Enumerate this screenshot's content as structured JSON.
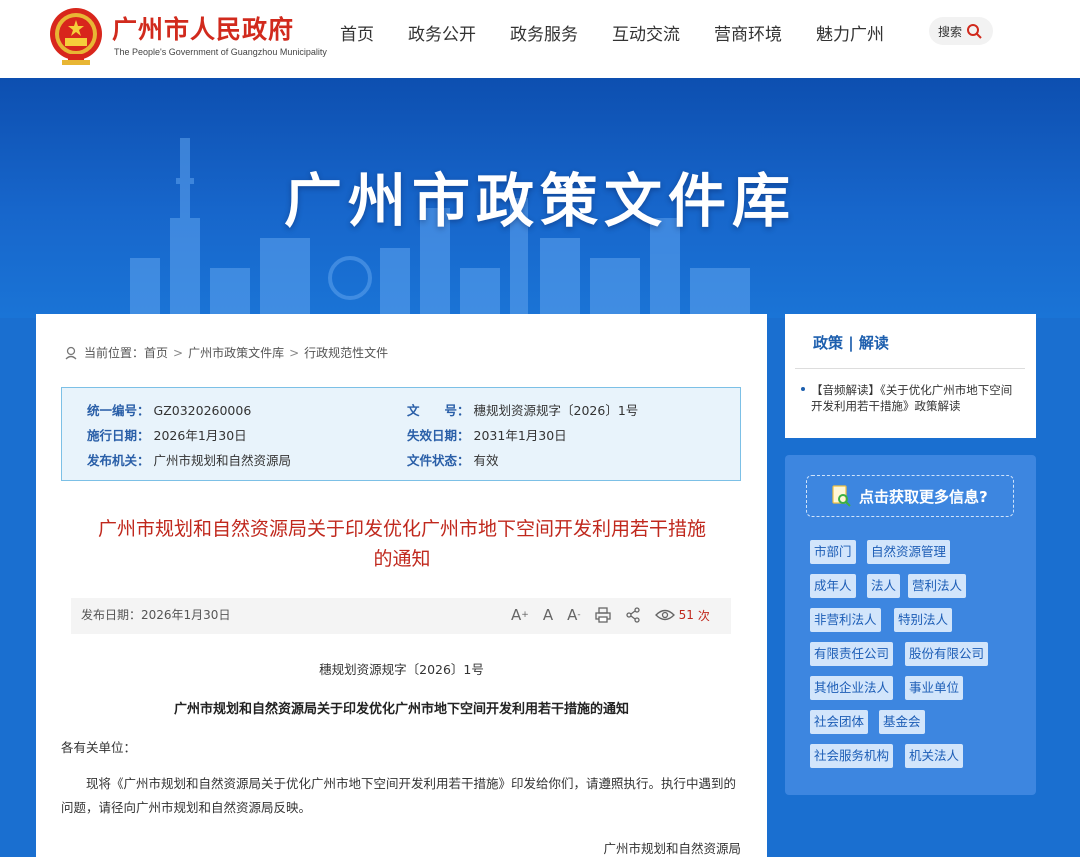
{
  "header": {
    "site_title": "广州市人民政府",
    "site_subtitle": "The People's Government of Guangzhou Municipality",
    "nav": [
      "首页",
      "政务公开",
      "政务服务",
      "互动交流",
      "营商环境",
      "魅力广州"
    ],
    "search_label": "搜索"
  },
  "banner": {
    "title": "广州市政策文件库"
  },
  "breadcrumb": {
    "prefix": "当前位置：",
    "items": [
      "首页",
      "广州市政策文件库",
      "行政规范性文件"
    ]
  },
  "info": {
    "serial_label": "统一编号：",
    "serial_value": "GZ0320260006",
    "docno_label": "文　　号：",
    "docno_value": "穗规划资源规字〔2026〕1号",
    "effective_label": "施行日期：",
    "effective_value": "2026年1月30日",
    "expiry_label": "失效日期：",
    "expiry_value": "2031年1月30日",
    "issuer_label": "发布机关：",
    "issuer_value": "广州市规划和自然资源局",
    "status_label": "文件状态：",
    "status_value": "有效"
  },
  "document": {
    "title": "广州市规划和自然资源局关于印发优化广州市地下空间开发利用若干措施的通知",
    "publish_date": "发布日期：2026年1月30日",
    "view_count": "51",
    "view_unit": "次",
    "doc_number": "穗规划资源规字〔2026〕1号",
    "heading": "广州市规划和自然资源局关于印发优化广州市地下空间开发利用若干措施的通知",
    "salutation": "各有关单位：",
    "body": "现将《广州市规划和自然资源局关于优化广州市地下空间开发利用若干措施》印发给你们，请遵照执行。执行中遇到的问题，请径向广州市规划和自然资源局反映。",
    "signature": "广州市规划和自然资源局"
  },
  "toolbar": {
    "font_large": "A",
    "font_medium": "A",
    "font_small": "A"
  },
  "sidebar": {
    "policy_title": "政策 | 解读",
    "policy_item": "【音频解读】《关于优化广州市地下空间开发利用若干措施》政策解读",
    "more_info": "点击获取更多信息?",
    "tags": [
      "市部门",
      "自然资源管理",
      "成年人",
      "法人",
      "营利法人",
      "非营利法人",
      "特别法人",
      "有限责任公司",
      "股份有限公司",
      "其他企业法人",
      "事业单位",
      "社会团体",
      "基金会",
      "社会服务机构",
      "机关法人"
    ]
  },
  "colors": {
    "brand_red": "#d12a1d",
    "banner_blue": "#1766cb",
    "tag_text": "#1c5db6",
    "title_red": "#c0281d"
  }
}
